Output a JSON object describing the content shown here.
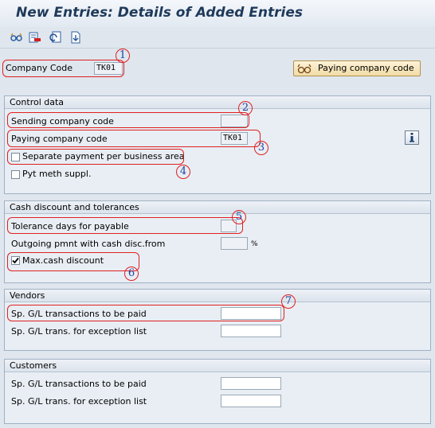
{
  "title": "New Entries: Details of Added Entries",
  "toolbar": {
    "icons": [
      "glasses-icon",
      "delete-row-icon",
      "undo-icon",
      "copy-doc-icon"
    ]
  },
  "header": {
    "company_code_label": "Company Code",
    "company_code_value": "TK01",
    "paying_button_label": "Paying company code"
  },
  "control": {
    "title": "Control data",
    "sending_label": "Sending company code",
    "sending_value": "",
    "paying_label": "Paying company code",
    "paying_value": "TK01",
    "separate_label": "Separate payment per business area",
    "separate_checked": false,
    "pyt_label": "Pyt meth suppl.",
    "pyt_checked": false
  },
  "cash": {
    "title": "Cash discount and tolerances",
    "tolerance_label": "Tolerance days for payable",
    "tolerance_value": "",
    "outgoing_label": "Outgoing pmnt with cash disc.from",
    "outgoing_value": "",
    "percent_sign": "%",
    "max_label": "Max.cash discount",
    "max_checked": true
  },
  "vendors": {
    "title": "Vendors",
    "sp_gl_label": "Sp. G/L transactions to be paid",
    "sp_gl_value": "",
    "exception_label": "Sp. G/L trans. for exception list",
    "exception_value": ""
  },
  "customers": {
    "title": "Customers",
    "sp_gl_label": "Sp. G/L transactions to be paid",
    "sp_gl_value": "",
    "exception_label": "Sp. G/L trans. for exception list",
    "exception_value": ""
  },
  "annotations": [
    "1",
    "2",
    "3",
    "4",
    "5",
    "6",
    "7"
  ],
  "colors": {
    "annotation_red": "#e02020",
    "annotation_number": "#2040a0",
    "button_bg": "#f2dca6"
  }
}
